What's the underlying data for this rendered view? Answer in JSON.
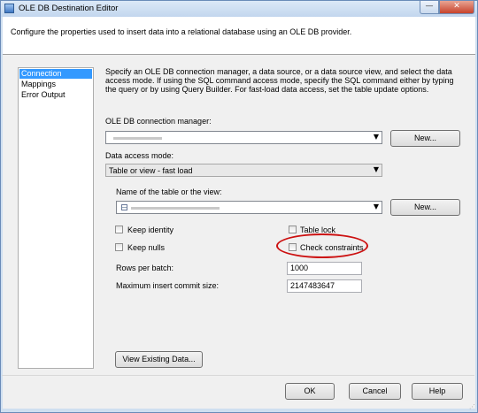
{
  "window": {
    "title": "OLE DB Destination Editor",
    "minimize_glyph": "—",
    "close_glyph": "✕"
  },
  "header": {
    "text": "Configure the properties used to insert data into a relational database using an OLE DB provider."
  },
  "nav": {
    "items": [
      {
        "label": "Connection Manager",
        "selected": true
      },
      {
        "label": "Mappings",
        "selected": false
      },
      {
        "label": "Error Output",
        "selected": false
      }
    ]
  },
  "panel": {
    "description": "Specify an OLE DB connection manager, a data source, or a data source view, and select the data access mode. If using the SQL command access mode, specify the SQL command either by typing the query or by using Query Builder. For fast-load data access, set the table update options.",
    "connection_manager": {
      "label": "OLE DB connection manager:",
      "new_button": "New..."
    },
    "data_access_mode": {
      "label": "Data access mode:",
      "value": "Table or view - fast load"
    },
    "table_or_view": {
      "label": "Name of the table or the view:",
      "new_button": "New..."
    },
    "options": {
      "keep_identity": "Keep identity",
      "table_lock": "Table lock",
      "keep_nulls": "Keep nulls",
      "check_constraints": "Check constraints"
    },
    "rows_per_batch": {
      "label": "Rows per batch:",
      "value": "1000"
    },
    "max_insert_commit_size": {
      "label": "Maximum insert commit size:",
      "value": "2147483647"
    },
    "view_existing_data_button": "View Existing Data..."
  },
  "footer": {
    "ok": "OK",
    "cancel": "Cancel",
    "help": "Help"
  },
  "colors": {
    "selection": "#3399ff",
    "highlight_ellipse": "#cc1111"
  }
}
